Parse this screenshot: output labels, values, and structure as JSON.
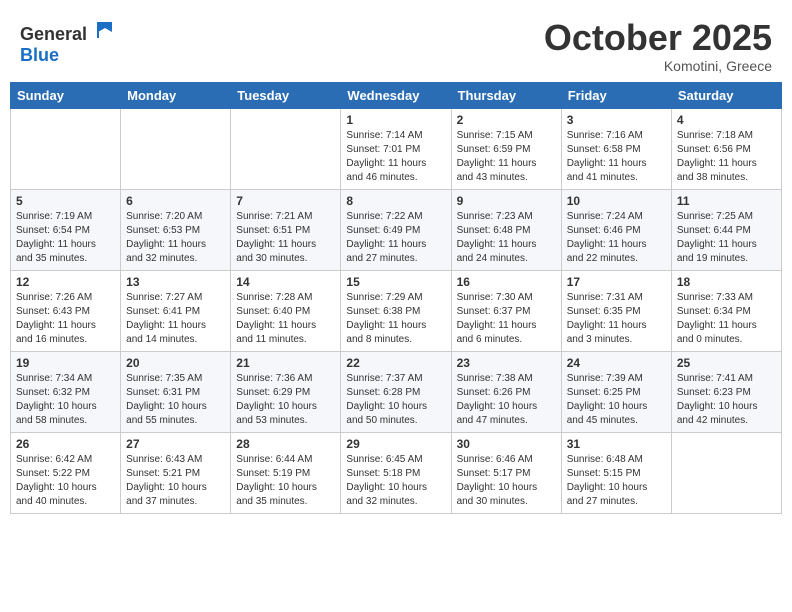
{
  "logo": {
    "general": "General",
    "blue": "Blue"
  },
  "title": "October 2025",
  "location": "Komotini, Greece",
  "days_header": [
    "Sunday",
    "Monday",
    "Tuesday",
    "Wednesday",
    "Thursday",
    "Friday",
    "Saturday"
  ],
  "weeks": [
    [
      {
        "day": "",
        "info": ""
      },
      {
        "day": "",
        "info": ""
      },
      {
        "day": "",
        "info": ""
      },
      {
        "day": "1",
        "info": "Sunrise: 7:14 AM\nSunset: 7:01 PM\nDaylight: 11 hours and 46 minutes."
      },
      {
        "day": "2",
        "info": "Sunrise: 7:15 AM\nSunset: 6:59 PM\nDaylight: 11 hours and 43 minutes."
      },
      {
        "day": "3",
        "info": "Sunrise: 7:16 AM\nSunset: 6:58 PM\nDaylight: 11 hours and 41 minutes."
      },
      {
        "day": "4",
        "info": "Sunrise: 7:18 AM\nSunset: 6:56 PM\nDaylight: 11 hours and 38 minutes."
      }
    ],
    [
      {
        "day": "5",
        "info": "Sunrise: 7:19 AM\nSunset: 6:54 PM\nDaylight: 11 hours and 35 minutes."
      },
      {
        "day": "6",
        "info": "Sunrise: 7:20 AM\nSunset: 6:53 PM\nDaylight: 11 hours and 32 minutes."
      },
      {
        "day": "7",
        "info": "Sunrise: 7:21 AM\nSunset: 6:51 PM\nDaylight: 11 hours and 30 minutes."
      },
      {
        "day": "8",
        "info": "Sunrise: 7:22 AM\nSunset: 6:49 PM\nDaylight: 11 hours and 27 minutes."
      },
      {
        "day": "9",
        "info": "Sunrise: 7:23 AM\nSunset: 6:48 PM\nDaylight: 11 hours and 24 minutes."
      },
      {
        "day": "10",
        "info": "Sunrise: 7:24 AM\nSunset: 6:46 PM\nDaylight: 11 hours and 22 minutes."
      },
      {
        "day": "11",
        "info": "Sunrise: 7:25 AM\nSunset: 6:44 PM\nDaylight: 11 hours and 19 minutes."
      }
    ],
    [
      {
        "day": "12",
        "info": "Sunrise: 7:26 AM\nSunset: 6:43 PM\nDaylight: 11 hours and 16 minutes."
      },
      {
        "day": "13",
        "info": "Sunrise: 7:27 AM\nSunset: 6:41 PM\nDaylight: 11 hours and 14 minutes."
      },
      {
        "day": "14",
        "info": "Sunrise: 7:28 AM\nSunset: 6:40 PM\nDaylight: 11 hours and 11 minutes."
      },
      {
        "day": "15",
        "info": "Sunrise: 7:29 AM\nSunset: 6:38 PM\nDaylight: 11 hours and 8 minutes."
      },
      {
        "day": "16",
        "info": "Sunrise: 7:30 AM\nSunset: 6:37 PM\nDaylight: 11 hours and 6 minutes."
      },
      {
        "day": "17",
        "info": "Sunrise: 7:31 AM\nSunset: 6:35 PM\nDaylight: 11 hours and 3 minutes."
      },
      {
        "day": "18",
        "info": "Sunrise: 7:33 AM\nSunset: 6:34 PM\nDaylight: 11 hours and 0 minutes."
      }
    ],
    [
      {
        "day": "19",
        "info": "Sunrise: 7:34 AM\nSunset: 6:32 PM\nDaylight: 10 hours and 58 minutes."
      },
      {
        "day": "20",
        "info": "Sunrise: 7:35 AM\nSunset: 6:31 PM\nDaylight: 10 hours and 55 minutes."
      },
      {
        "day": "21",
        "info": "Sunrise: 7:36 AM\nSunset: 6:29 PM\nDaylight: 10 hours and 53 minutes."
      },
      {
        "day": "22",
        "info": "Sunrise: 7:37 AM\nSunset: 6:28 PM\nDaylight: 10 hours and 50 minutes."
      },
      {
        "day": "23",
        "info": "Sunrise: 7:38 AM\nSunset: 6:26 PM\nDaylight: 10 hours and 47 minutes."
      },
      {
        "day": "24",
        "info": "Sunrise: 7:39 AM\nSunset: 6:25 PM\nDaylight: 10 hours and 45 minutes."
      },
      {
        "day": "25",
        "info": "Sunrise: 7:41 AM\nSunset: 6:23 PM\nDaylight: 10 hours and 42 minutes."
      }
    ],
    [
      {
        "day": "26",
        "info": "Sunrise: 6:42 AM\nSunset: 5:22 PM\nDaylight: 10 hours and 40 minutes."
      },
      {
        "day": "27",
        "info": "Sunrise: 6:43 AM\nSunset: 5:21 PM\nDaylight: 10 hours and 37 minutes."
      },
      {
        "day": "28",
        "info": "Sunrise: 6:44 AM\nSunset: 5:19 PM\nDaylight: 10 hours and 35 minutes."
      },
      {
        "day": "29",
        "info": "Sunrise: 6:45 AM\nSunset: 5:18 PM\nDaylight: 10 hours and 32 minutes."
      },
      {
        "day": "30",
        "info": "Sunrise: 6:46 AM\nSunset: 5:17 PM\nDaylight: 10 hours and 30 minutes."
      },
      {
        "day": "31",
        "info": "Sunrise: 6:48 AM\nSunset: 5:15 PM\nDaylight: 10 hours and 27 minutes."
      },
      {
        "day": "",
        "info": ""
      }
    ]
  ]
}
